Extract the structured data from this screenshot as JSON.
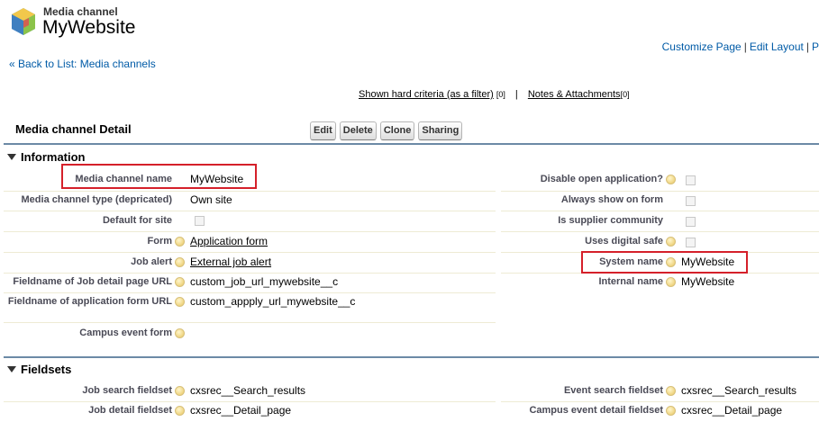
{
  "header": {
    "object_type": "Media channel",
    "title": "MyWebsite",
    "customize_page": "Customize Page",
    "edit_layout": "Edit Layout",
    "more_link": "P",
    "separator": "|",
    "back_link": "« Back to List: Media channels"
  },
  "hover_links": {
    "hard_criteria": "Shown hard criteria (as a filter)",
    "hard_criteria_count": "[0]",
    "notes": "Notes & Attachments",
    "notes_count": "[0]",
    "separator": "|"
  },
  "detail": {
    "title": "Media channel Detail",
    "buttons": {
      "edit": "Edit",
      "delete": "Delete",
      "clone": "Clone",
      "sharing": "Sharing"
    }
  },
  "sections": {
    "information": {
      "title": "Information",
      "left": {
        "media_channel_name": {
          "label": "Media channel name",
          "value": "MyWebsite"
        },
        "media_channel_type": {
          "label": "Media channel type (depricated)",
          "value": "Own site"
        },
        "default_for_site": {
          "label": "Default for site",
          "checked": false
        },
        "form": {
          "label": "Form",
          "value": "Application form"
        },
        "job_alert": {
          "label": "Job alert",
          "value": "External job alert"
        },
        "fieldname_job_detail": {
          "label": "Fieldname of Job detail page URL",
          "value": "custom_job_url_mywebsite__c"
        },
        "fieldname_application_form": {
          "label": "Fieldname of application form URL",
          "value": "custom_appply_url_mywebsite__c"
        },
        "campus_event_form": {
          "label": "Campus event form",
          "value": ""
        }
      },
      "right": {
        "disable_open_application": {
          "label": "Disable open application?",
          "checked": false
        },
        "always_show_on_form": {
          "label": "Always show on form",
          "checked": false
        },
        "is_supplier_community": {
          "label": "Is supplier community",
          "checked": false
        },
        "uses_digital_safe": {
          "label": "Uses digital safe",
          "checked": false
        },
        "system_name": {
          "label": "System name",
          "value": "MyWebsite"
        },
        "internal_name": {
          "label": "Internal name",
          "value": "MyWebsite"
        }
      }
    },
    "fieldsets": {
      "title": "Fieldsets",
      "left": {
        "job_search_fieldset": {
          "label": "Job search fieldset",
          "value": "cxsrec__Search_results"
        },
        "job_detail_fieldset": {
          "label": "Job detail fieldset",
          "value": "cxsrec__Detail_page"
        }
      },
      "right": {
        "event_search_fieldset": {
          "label": "Event search fieldset",
          "value": "cxsrec__Search_results"
        },
        "campus_event_detail_fieldset": {
          "label": "Campus event detail fieldset",
          "value": "cxsrec__Detail_page"
        }
      }
    }
  },
  "colors": {
    "link": "#015ba7",
    "highlight_box": "#d5202a",
    "section_rule": "#6c8aa6"
  }
}
